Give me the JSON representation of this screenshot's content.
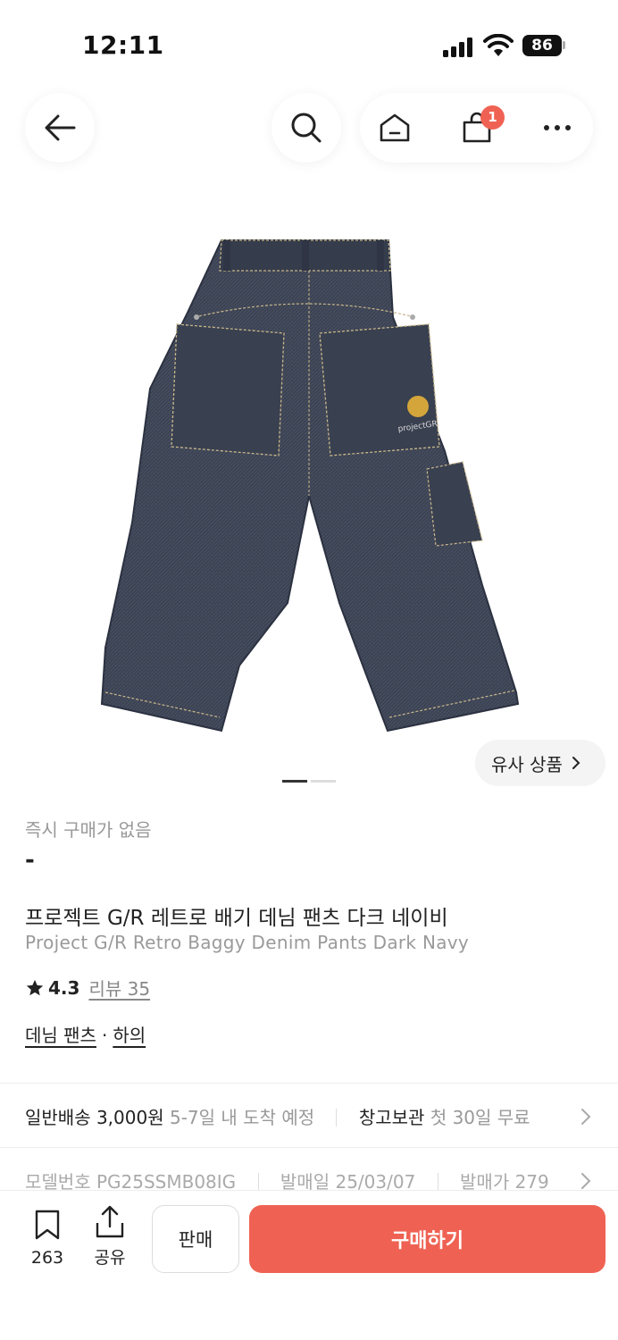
{
  "status_bar": {
    "time": "12:11",
    "battery": "86"
  },
  "header": {
    "cart_count": "1"
  },
  "gallery": {
    "similar_label": "유사 상품",
    "page_count": 2,
    "current_page": 1
  },
  "product": {
    "instant_label": "즉시 구매가 없음",
    "price": "-",
    "title_ko": "프로젝트 G/R 레트로 배기 데님 팬츠 다크 네이비",
    "title_en": "Project G/R Retro Baggy Denim Pants Dark Navy",
    "rating": "4.3",
    "review_label": "리뷰 35",
    "category_primary": "데님 팬츠",
    "category_sep": "·",
    "category_secondary": "하의",
    "image_logo_text": "projectGR"
  },
  "shipping": {
    "method": "일반배송 3,000원",
    "eta": "5-7일 내 도착 예정",
    "storage_label": "창고보관",
    "storage_value": "첫 30일 무료"
  },
  "model_info": {
    "model": "모델번호 PG25SSMB08IG",
    "release": "발매일 25/03/07",
    "retail": "발매가 279"
  },
  "bottom_bar": {
    "bookmark_count": "263",
    "share_label": "공유",
    "sell_label": "판매",
    "buy_label": "구매하기"
  },
  "colors": {
    "accent": "#ef6253",
    "denim": "#3a4150",
    "stitch": "#c9b78a"
  }
}
